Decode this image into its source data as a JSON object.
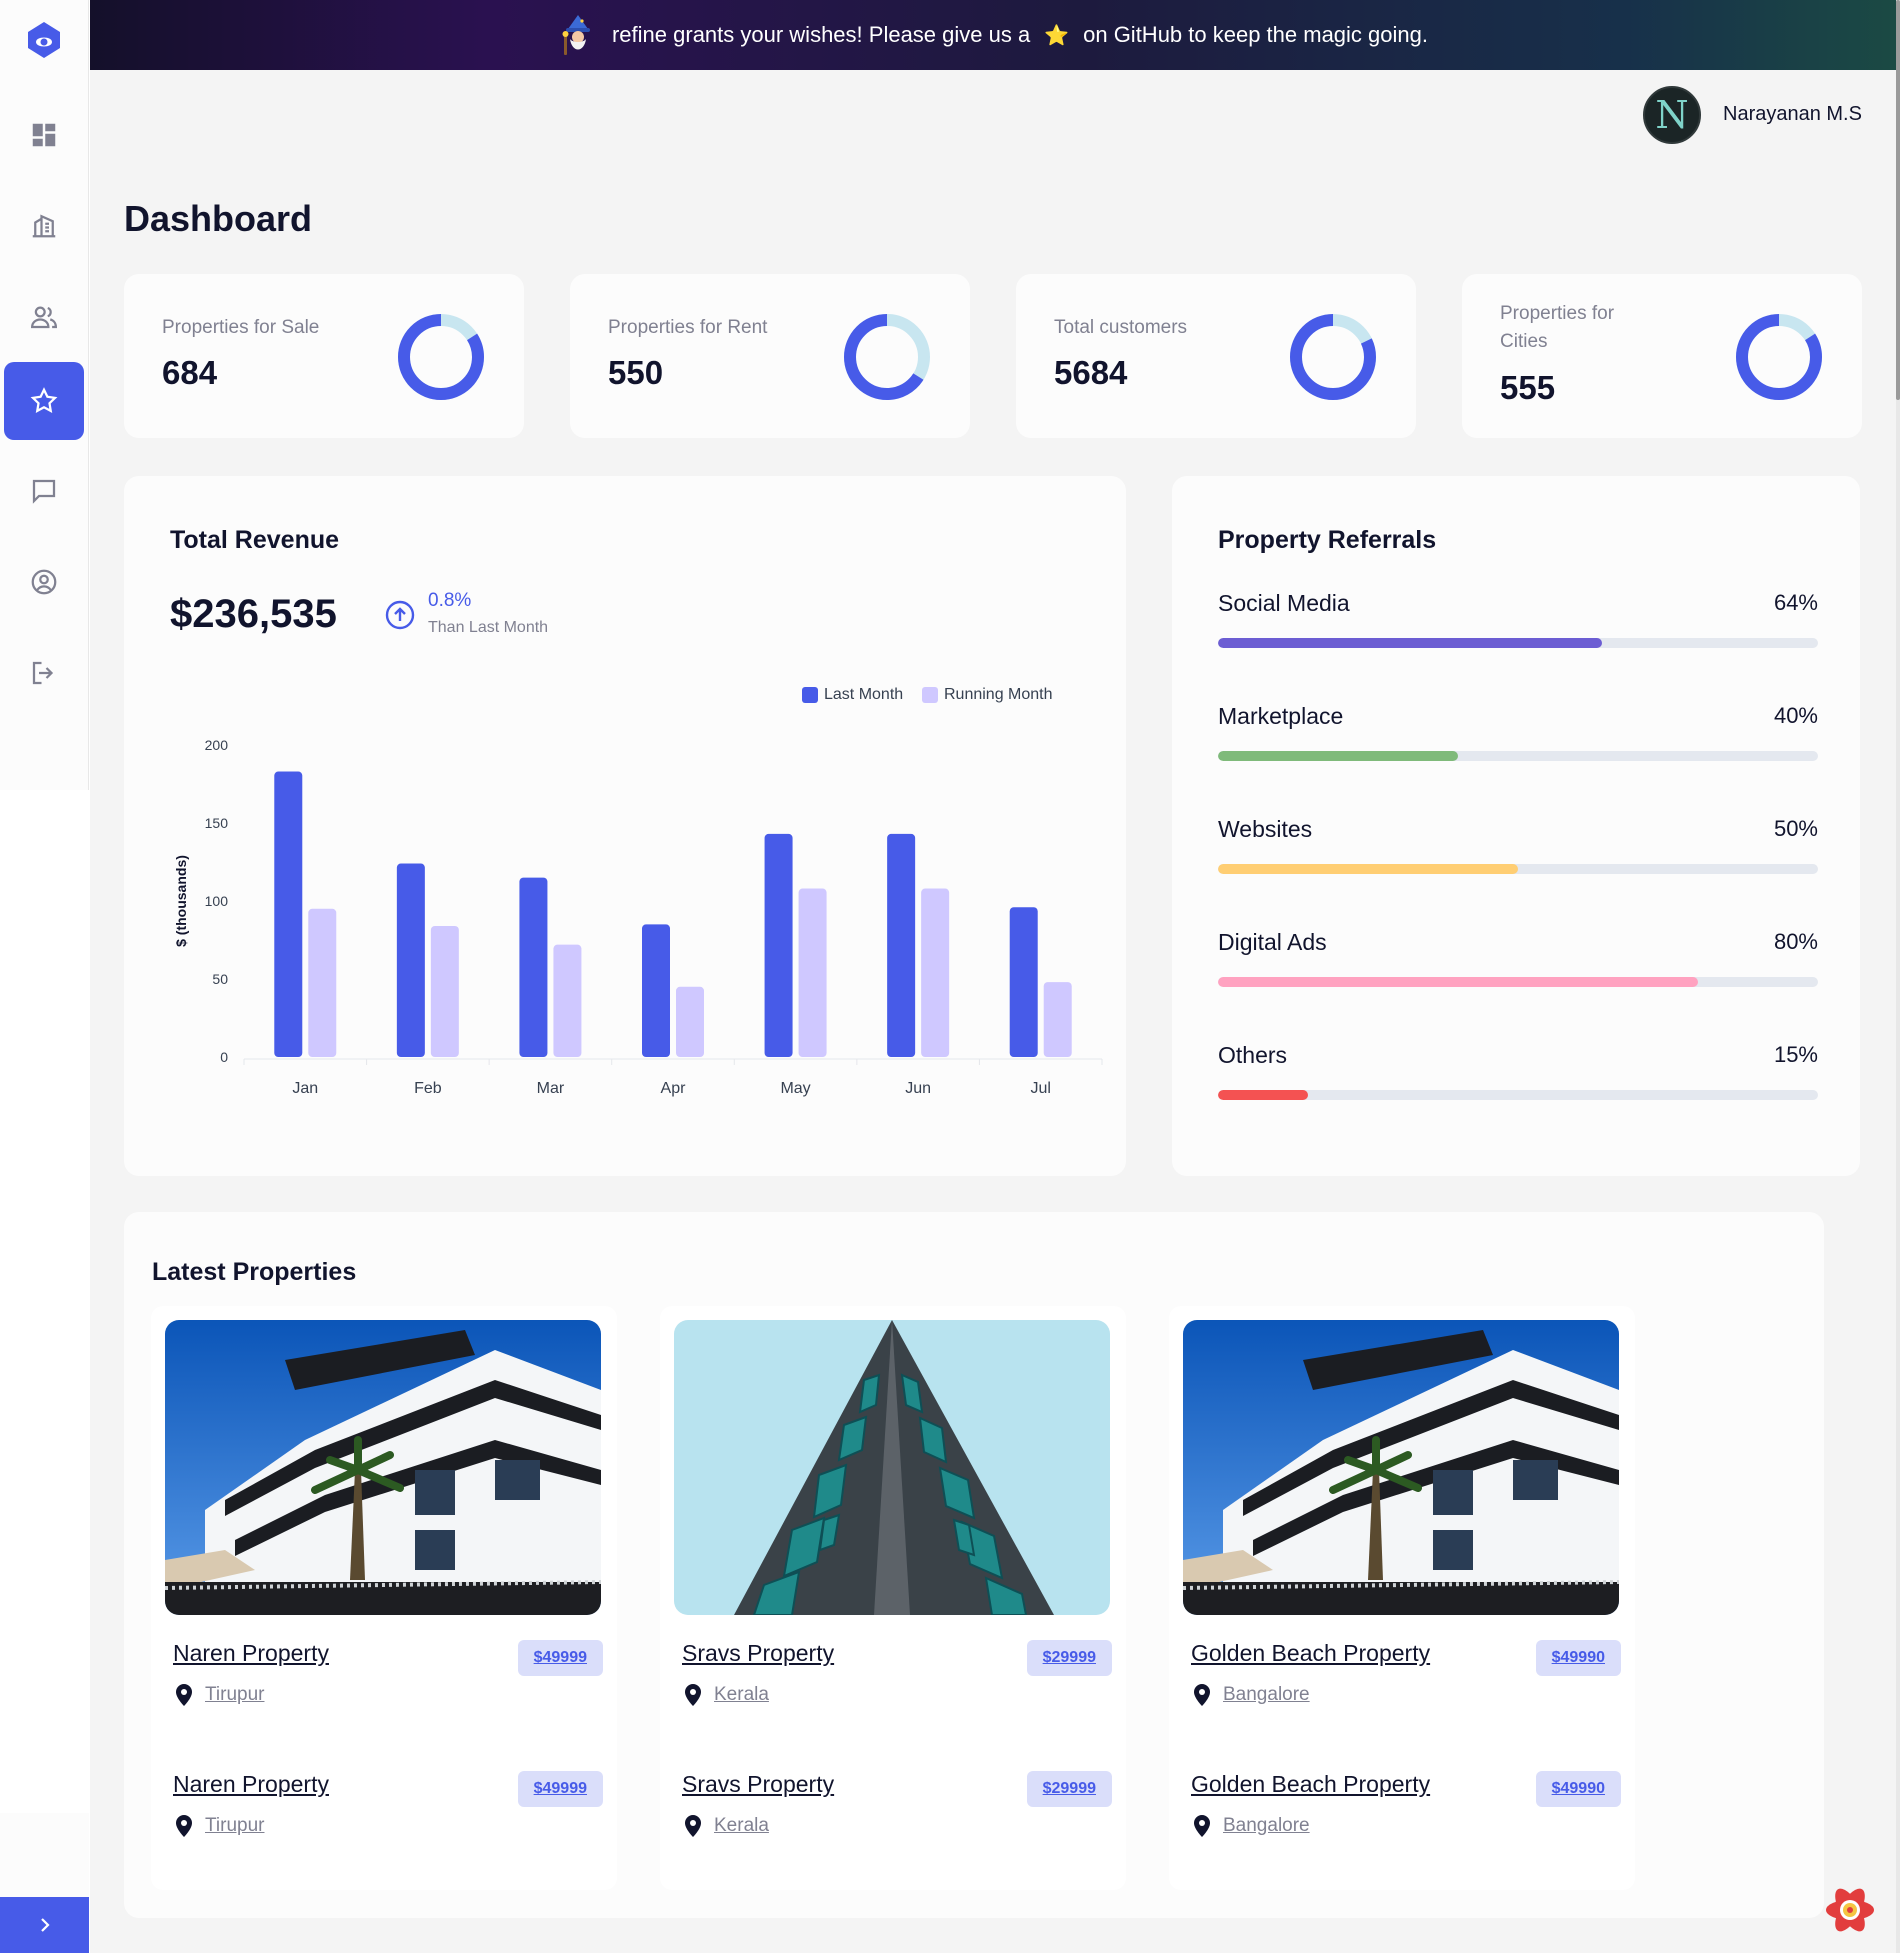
{
  "banner": {
    "text_before": "refine grants your wishes! Please give us a",
    "star": "⭐",
    "text_after": "on GitHub to keep the magic going."
  },
  "user": {
    "name": "Narayanan M.S",
    "initial": "N"
  },
  "sidebar": {
    "items": [
      {
        "icon": "dashboard-icon"
      },
      {
        "icon": "properties-icon"
      },
      {
        "icon": "agents-icon"
      },
      {
        "icon": "star-icon",
        "active": true
      },
      {
        "icon": "message-icon"
      },
      {
        "icon": "profile-icon"
      },
      {
        "icon": "logout-icon"
      }
    ],
    "toggle": "›"
  },
  "page": {
    "title": "Dashboard"
  },
  "stats": [
    {
      "label": "Properties for Sale",
      "value": "684",
      "donut_share": 0.84
    },
    {
      "label": "Properties for Rent",
      "value": "550",
      "donut_share": 0.66
    },
    {
      "label": "Total customers",
      "value": "5684",
      "donut_share": 0.82
    },
    {
      "label": "Properties for Cities",
      "value": "555",
      "donut_share": 0.84
    }
  ],
  "revenue": {
    "title": "Total Revenue",
    "amount": "$236,535",
    "change_percent": "0.8%",
    "change_text": "Than Last Month"
  },
  "chart_data": {
    "type": "bar",
    "categories": [
      "Jan",
      "Feb",
      "Mar",
      "Apr",
      "May",
      "Jun",
      "Jul"
    ],
    "series": [
      {
        "name": "Last Month",
        "values": [
          183,
          124,
          115,
          85,
          143,
          143,
          96
        ],
        "color": "#475be8"
      },
      {
        "name": "Running Month",
        "values": [
          95,
          84,
          72,
          45,
          108,
          108,
          48
        ],
        "color": "#cfc8ff"
      }
    ],
    "ylabel": "$ (thousands)",
    "yticks": [
      "0",
      "50",
      "100",
      "150",
      "200"
    ],
    "ylim": [
      0,
      200
    ],
    "legend_position": "top-right",
    "grid": false
  },
  "referrals": {
    "title": "Property Referrals",
    "items": [
      {
        "name": "Social Media",
        "percent": "64%",
        "value": 64,
        "color": "#6c5dd3"
      },
      {
        "name": "Marketplace",
        "percent": "40%",
        "value": 40,
        "color": "#7fba7a"
      },
      {
        "name": "Websites",
        "percent": "50%",
        "value": 50,
        "color": "#ffce73"
      },
      {
        "name": "Digital Ads",
        "percent": "80%",
        "value": 80,
        "color": "#ffa2c0"
      },
      {
        "name": "Others",
        "percent": "15%",
        "value": 15,
        "color": "#f45252"
      }
    ]
  },
  "latest": {
    "title": "Latest Properties",
    "cards": [
      {
        "image": "white-villa-photo",
        "entries": [
          {
            "title": "Naren Property",
            "price": "$49999",
            "location": "Tirupur"
          },
          {
            "title": "Naren Property",
            "price": "$49999",
            "location": "Tirupur"
          }
        ]
      },
      {
        "image": "teal-tower-photo",
        "entries": [
          {
            "title": "Sravs Property",
            "price": "$29999",
            "location": "Kerala"
          },
          {
            "title": "Sravs Property",
            "price": "$29999",
            "location": "Kerala"
          }
        ]
      },
      {
        "image": "white-villa-photo",
        "entries": [
          {
            "title": "Golden Beach Property",
            "price": "$49990",
            "location": "Bangalore"
          },
          {
            "title": "Golden Beach Property",
            "price": "$49990",
            "location": "Bangalore"
          }
        ]
      }
    ]
  },
  "colors": {
    "accent": "#475be8",
    "donut_track": "#c8e6f0",
    "page_bg": "#f4f4f4",
    "card_bg": "#fcfcfc"
  }
}
